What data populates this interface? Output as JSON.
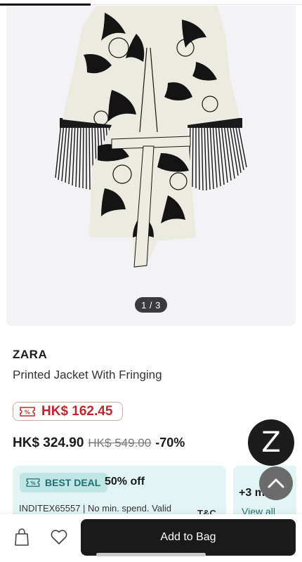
{
  "gallery": {
    "page_indicator": "1 / 3",
    "image_progress": 0.3
  },
  "product": {
    "brand": "ZARA",
    "name": "Printed Jacket With Fringing"
  },
  "sale": {
    "icon": "percent-tag-icon",
    "price": "HK$ 162.45"
  },
  "pricing": {
    "current": "HK$ 324.90",
    "original": "HK$ 549.00",
    "discount": "-70%"
  },
  "deal": {
    "badge_icon": "percent-tag-icon",
    "badge": "BEST DEAL",
    "off": "50% off",
    "code_text": "INDITEX65557 | No min. spend. Valid",
    "tc": "T&C"
  },
  "more_deals": {
    "count": "+3 m",
    "view_all": "View all"
  },
  "floating": {
    "brand_letter": "Z",
    "scroll_top_icon": "chevron-up-icon"
  },
  "bottom_bar": {
    "bag_icon": "shopping-bag-icon",
    "wishlist_icon": "heart-icon",
    "add_to_bag": "Add to Bag"
  },
  "colors": {
    "sale_red": "#c0272d",
    "deal_bg": "#e3f4f4",
    "deal_accent": "#1f6f70",
    "button_dark": "#1a1a1a"
  }
}
